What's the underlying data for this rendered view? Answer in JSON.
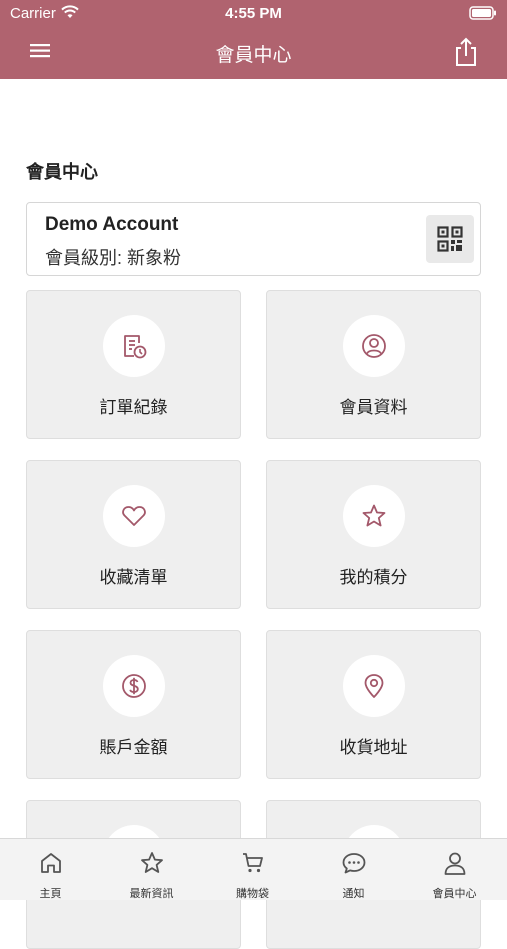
{
  "status_bar": {
    "carrier": "Carrier",
    "time": "4:55 PM"
  },
  "header": {
    "title": "會員中心"
  },
  "section": {
    "title": "會員中心"
  },
  "account": {
    "name": "Demo Account",
    "level": "會員級別: 新象粉"
  },
  "tiles": [
    {
      "label": "訂單紀錄",
      "icon": "order-icon"
    },
    {
      "label": "會員資料",
      "icon": "profile-icon"
    },
    {
      "label": "收藏清單",
      "icon": "heart-icon"
    },
    {
      "label": "我的積分",
      "icon": "star-icon"
    },
    {
      "label": "賬戶金額",
      "icon": "dollar-icon"
    },
    {
      "label": "收貨地址",
      "icon": "location-icon"
    }
  ],
  "tabbar": [
    {
      "label": "主頁",
      "icon": "home-icon"
    },
    {
      "label": "最新資訊",
      "icon": "star-icon"
    },
    {
      "label": "購物袋",
      "icon": "cart-icon"
    },
    {
      "label": "通知",
      "icon": "chat-icon"
    },
    {
      "label": "會員中心",
      "icon": "user-icon"
    }
  ],
  "colors": {
    "accent": "#b0636f",
    "icon": "#a3586a",
    "tile_bg": "#efefef",
    "tabbar_bg": "#f3f3f3"
  }
}
